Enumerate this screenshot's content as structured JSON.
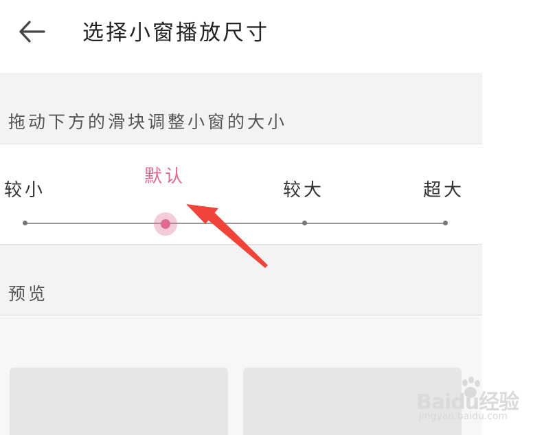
{
  "header": {
    "back_icon": "arrow-left-icon",
    "title": "选择小窗播放尺寸"
  },
  "size_section": {
    "hint": "拖动下方的滑块调整小窗的大小",
    "options": [
      "较小",
      "默认",
      "较大",
      "超大"
    ],
    "selected_index": 1,
    "accent_color": "#e0698f"
  },
  "preview_section": {
    "label": "预览"
  },
  "annotation": {
    "arrow_color": "#f0433a"
  },
  "watermark": {
    "logo_text": "Baidu经验",
    "url": "jingyan.baidu.com"
  }
}
